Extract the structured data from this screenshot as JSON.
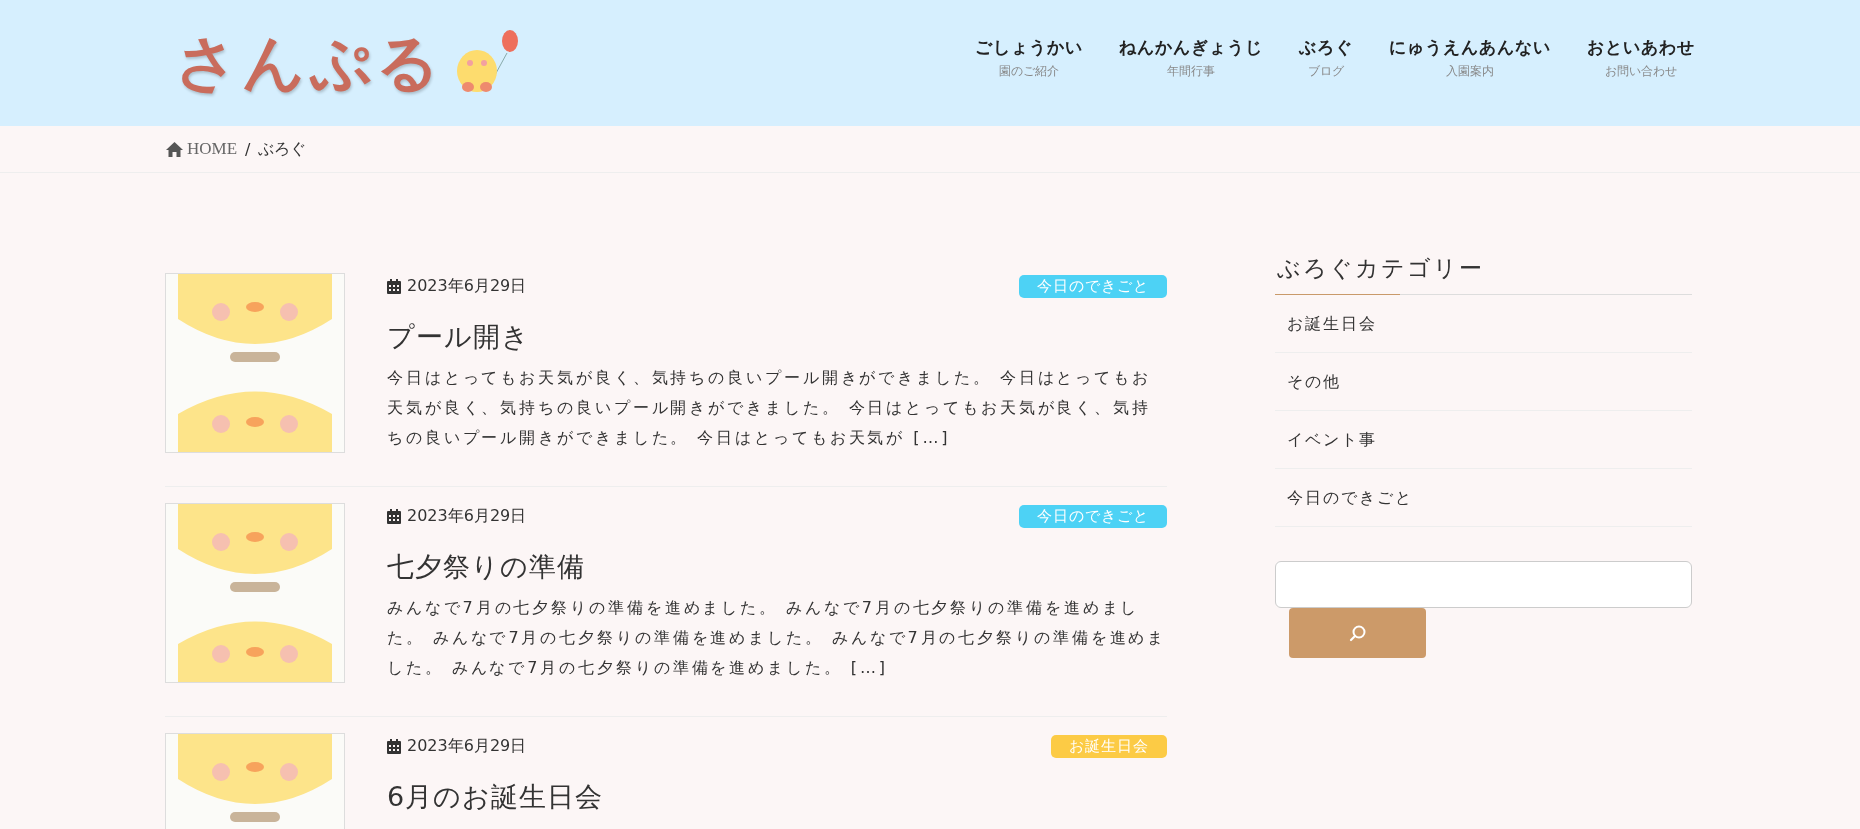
{
  "header": {
    "logo": "さんぷる",
    "nav": [
      {
        "label": "ごしょうかい",
        "sub": "園のご紹介"
      },
      {
        "label": "ねんかんぎょうじ",
        "sub": "年間行事"
      },
      {
        "label": "ぶろぐ",
        "sub": "ブログ"
      },
      {
        "label": "にゅうえんあんない",
        "sub": "入園案内"
      },
      {
        "label": "おといあわせ",
        "sub": "お問い合わせ"
      }
    ]
  },
  "breadcrumb": {
    "home": "HOME",
    "separator": "/",
    "current": "ぶろぐ"
  },
  "posts": [
    {
      "date": "2023年6月29日",
      "category": {
        "label": "今日のできごと",
        "color": "#4dd2f5"
      },
      "title": "プール開き",
      "excerpt": "今日はとってもお天気が良く、気持ちの良いプール開きができました。 今日はとってもお天気が良く、気持ちの良いプール開きができました。 今日はとってもお天気が良く、気持ちの良いプール開きができました。 今日はとってもお天気が […]"
    },
    {
      "date": "2023年6月29日",
      "category": {
        "label": "今日のできごと",
        "color": "#4dd2f5"
      },
      "title": "七夕祭りの準備",
      "excerpt": "みんなで7月の七夕祭りの準備を進めました。 みんなで7月の七夕祭りの準備を進めました。 みんなで7月の七夕祭りの準備を進めました。 みんなで7月の七夕祭りの準備を進めました。 みんなで7月の七夕祭りの準備を進めました。 […]"
    },
    {
      "date": "2023年6月29日",
      "category": {
        "label": "お誕生日会",
        "color": "#fccb45"
      },
      "title": "6月のお誕生日会"
    }
  ],
  "sidebar": {
    "title": "ぶろぐカテゴリー",
    "categories": [
      "お誕生日会",
      "その他",
      "イベント事",
      "今日のできごと"
    ]
  }
}
